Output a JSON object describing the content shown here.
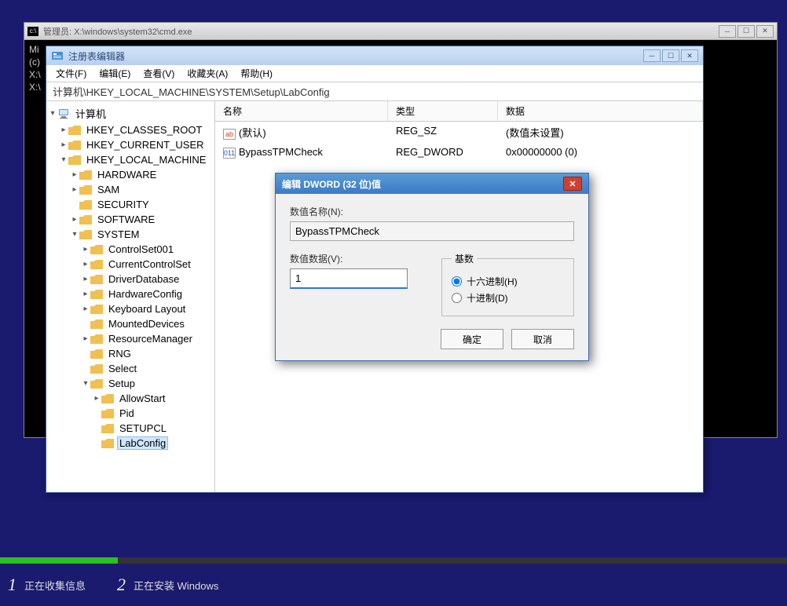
{
  "cmd": {
    "title": "管理员: X:\\windows\\system32\\cmd.exe",
    "lines": [
      "Mi",
      "(c)",
      "",
      "X:\\",
      "",
      "X:\\"
    ]
  },
  "regedit": {
    "title": "注册表编辑器",
    "menu": [
      "文件(F)",
      "编辑(E)",
      "查看(V)",
      "收藏夹(A)",
      "帮助(H)"
    ],
    "path": "计算机\\HKEY_LOCAL_MACHINE\\SYSTEM\\Setup\\LabConfig",
    "cols": {
      "name": "名称",
      "type": "类型",
      "data": "数据"
    },
    "rows": [
      {
        "icon": "sz",
        "name": "(默认)",
        "type": "REG_SZ",
        "data": "(数值未设置)"
      },
      {
        "icon": "dw",
        "name": "BypassTPMCheck",
        "type": "REG_DWORD",
        "data": "0x00000000 (0)"
      }
    ],
    "tree": {
      "root": "计算机",
      "hkcr": "HKEY_CLASSES_ROOT",
      "hkcu": "HKEY_CURRENT_USER",
      "hklm": "HKEY_LOCAL_MACHINE",
      "hardware": "HARDWARE",
      "sam": "SAM",
      "security": "SECURITY",
      "software": "SOFTWARE",
      "system": "SYSTEM",
      "cs001": "ControlSet001",
      "ccs": "CurrentControlSet",
      "drvdb": "DriverDatabase",
      "hwcfg": "HardwareConfig",
      "kblayout": "Keyboard Layout",
      "mounted": "MountedDevices",
      "resmgr": "ResourceManager",
      "rng": "RNG",
      "select": "Select",
      "setup": "Setup",
      "allowstart": "AllowStart",
      "pid": "Pid",
      "setupcl": "SETUPCL",
      "labconfig": "LabConfig"
    }
  },
  "dialog": {
    "title": "编辑 DWORD (32 位)值",
    "name_label": "数值名称(N):",
    "name_value": "BypassTPMCheck",
    "data_label": "数值数据(V):",
    "data_value": "1",
    "radix_label": "基数",
    "radix_hex": "十六进制(H)",
    "radix_dec": "十进制(D)",
    "ok": "确定",
    "cancel": "取消"
  },
  "status": {
    "step1_num": "1",
    "step1_text": "正在收集信息",
    "step2_num": "2",
    "step2_text": "正在安装 Windows"
  }
}
